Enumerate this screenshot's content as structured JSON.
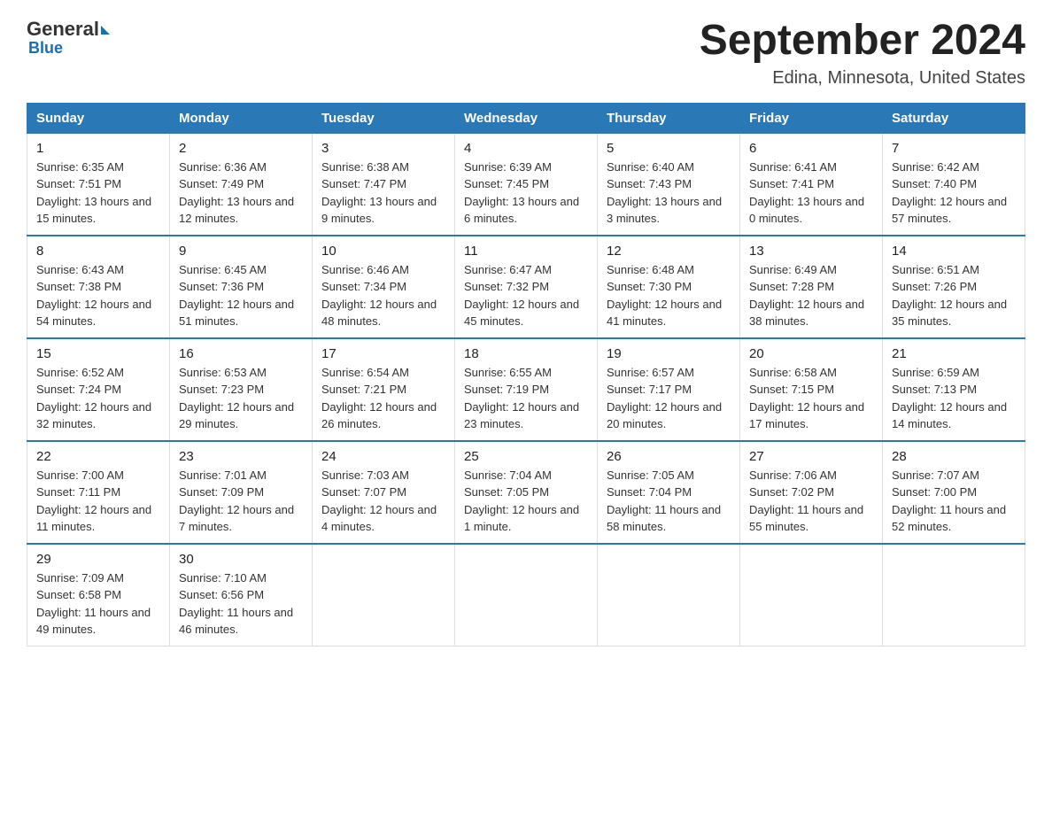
{
  "header": {
    "logo_general": "General",
    "logo_blue": "Blue",
    "calendar_title": "September 2024",
    "calendar_subtitle": "Edina, Minnesota, United States"
  },
  "days_of_week": [
    "Sunday",
    "Monday",
    "Tuesday",
    "Wednesday",
    "Thursday",
    "Friday",
    "Saturday"
  ],
  "weeks": [
    [
      {
        "day": "1",
        "sunrise": "6:35 AM",
        "sunset": "7:51 PM",
        "daylight": "13 hours and 15 minutes."
      },
      {
        "day": "2",
        "sunrise": "6:36 AM",
        "sunset": "7:49 PM",
        "daylight": "13 hours and 12 minutes."
      },
      {
        "day": "3",
        "sunrise": "6:38 AM",
        "sunset": "7:47 PM",
        "daylight": "13 hours and 9 minutes."
      },
      {
        "day": "4",
        "sunrise": "6:39 AM",
        "sunset": "7:45 PM",
        "daylight": "13 hours and 6 minutes."
      },
      {
        "day": "5",
        "sunrise": "6:40 AM",
        "sunset": "7:43 PM",
        "daylight": "13 hours and 3 minutes."
      },
      {
        "day": "6",
        "sunrise": "6:41 AM",
        "sunset": "7:41 PM",
        "daylight": "13 hours and 0 minutes."
      },
      {
        "day": "7",
        "sunrise": "6:42 AM",
        "sunset": "7:40 PM",
        "daylight": "12 hours and 57 minutes."
      }
    ],
    [
      {
        "day": "8",
        "sunrise": "6:43 AM",
        "sunset": "7:38 PM",
        "daylight": "12 hours and 54 minutes."
      },
      {
        "day": "9",
        "sunrise": "6:45 AM",
        "sunset": "7:36 PM",
        "daylight": "12 hours and 51 minutes."
      },
      {
        "day": "10",
        "sunrise": "6:46 AM",
        "sunset": "7:34 PM",
        "daylight": "12 hours and 48 minutes."
      },
      {
        "day": "11",
        "sunrise": "6:47 AM",
        "sunset": "7:32 PM",
        "daylight": "12 hours and 45 minutes."
      },
      {
        "day": "12",
        "sunrise": "6:48 AM",
        "sunset": "7:30 PM",
        "daylight": "12 hours and 41 minutes."
      },
      {
        "day": "13",
        "sunrise": "6:49 AM",
        "sunset": "7:28 PM",
        "daylight": "12 hours and 38 minutes."
      },
      {
        "day": "14",
        "sunrise": "6:51 AM",
        "sunset": "7:26 PM",
        "daylight": "12 hours and 35 minutes."
      }
    ],
    [
      {
        "day": "15",
        "sunrise": "6:52 AM",
        "sunset": "7:24 PM",
        "daylight": "12 hours and 32 minutes."
      },
      {
        "day": "16",
        "sunrise": "6:53 AM",
        "sunset": "7:23 PM",
        "daylight": "12 hours and 29 minutes."
      },
      {
        "day": "17",
        "sunrise": "6:54 AM",
        "sunset": "7:21 PM",
        "daylight": "12 hours and 26 minutes."
      },
      {
        "day": "18",
        "sunrise": "6:55 AM",
        "sunset": "7:19 PM",
        "daylight": "12 hours and 23 minutes."
      },
      {
        "day": "19",
        "sunrise": "6:57 AM",
        "sunset": "7:17 PM",
        "daylight": "12 hours and 20 minutes."
      },
      {
        "day": "20",
        "sunrise": "6:58 AM",
        "sunset": "7:15 PM",
        "daylight": "12 hours and 17 minutes."
      },
      {
        "day": "21",
        "sunrise": "6:59 AM",
        "sunset": "7:13 PM",
        "daylight": "12 hours and 14 minutes."
      }
    ],
    [
      {
        "day": "22",
        "sunrise": "7:00 AM",
        "sunset": "7:11 PM",
        "daylight": "12 hours and 11 minutes."
      },
      {
        "day": "23",
        "sunrise": "7:01 AM",
        "sunset": "7:09 PM",
        "daylight": "12 hours and 7 minutes."
      },
      {
        "day": "24",
        "sunrise": "7:03 AM",
        "sunset": "7:07 PM",
        "daylight": "12 hours and 4 minutes."
      },
      {
        "day": "25",
        "sunrise": "7:04 AM",
        "sunset": "7:05 PM",
        "daylight": "12 hours and 1 minute."
      },
      {
        "day": "26",
        "sunrise": "7:05 AM",
        "sunset": "7:04 PM",
        "daylight": "11 hours and 58 minutes."
      },
      {
        "day": "27",
        "sunrise": "7:06 AM",
        "sunset": "7:02 PM",
        "daylight": "11 hours and 55 minutes."
      },
      {
        "day": "28",
        "sunrise": "7:07 AM",
        "sunset": "7:00 PM",
        "daylight": "11 hours and 52 minutes."
      }
    ],
    [
      {
        "day": "29",
        "sunrise": "7:09 AM",
        "sunset": "6:58 PM",
        "daylight": "11 hours and 49 minutes."
      },
      {
        "day": "30",
        "sunrise": "7:10 AM",
        "sunset": "6:56 PM",
        "daylight": "11 hours and 46 minutes."
      },
      null,
      null,
      null,
      null,
      null
    ]
  ]
}
